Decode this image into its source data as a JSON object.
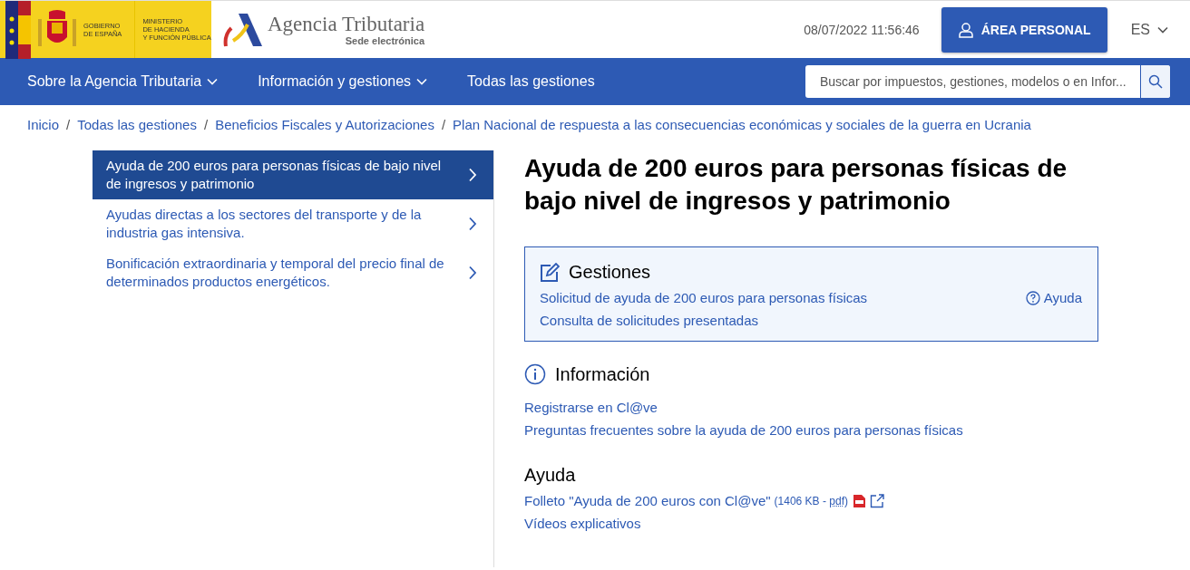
{
  "header": {
    "gov_logo": {
      "line_1": "GOBIERNO",
      "line_2": "DE ESPAÑA"
    },
    "ministry": [
      "MINISTERIO",
      "DE HACIENDA",
      "Y FUNCIÓN PÚBLICA"
    ],
    "agency": {
      "name": "Agencia Tributaria",
      "subtitle": "Sede electrónica"
    },
    "datetime": "08/07/2022 11:56:46",
    "personal_button": "ÁREA PERSONAL",
    "language": "ES"
  },
  "nav": {
    "items": [
      {
        "label": "Sobre la Agencia Tributaria",
        "has_menu": true
      },
      {
        "label": "Información y gestiones",
        "has_menu": true
      },
      {
        "label": "Todas las gestiones",
        "has_menu": false
      }
    ],
    "search": {
      "placeholder": "Buscar por impuestos, gestiones, modelos o en Infor..."
    }
  },
  "breadcrumb_separator": "/",
  "breadcrumb": [
    "Inicio",
    "Todas las gestiones",
    "Beneficios Fiscales y Autorizaciones",
    "Plan Nacional de respuesta a las consecuencias económicas y sociales de la guerra en Ucrania"
  ],
  "sidebar": {
    "items": [
      {
        "label": "Ayuda de 200 euros para personas físicas de bajo nivel de ingresos y patrimonio",
        "selected": true
      },
      {
        "label": "Ayudas directas a los sectores del transporte y de la industria gas intensiva.",
        "selected": false
      },
      {
        "label": "Bonificación extraordinaria y temporal del precio final de determinados productos energéticos.",
        "selected": false
      }
    ]
  },
  "content": {
    "title": "Ayuda de 200 euros para personas físicas de bajo nivel de ingresos y patrimonio",
    "gestiones": {
      "heading": "Gestiones",
      "links": [
        "Solicitud de ayuda de 200 euros para personas físicas",
        "Consulta de solicitudes presentadas"
      ],
      "help_link": "Ayuda"
    },
    "informacion": {
      "heading": "Información",
      "links": [
        "Registrarse en Cl@ve",
        "Preguntas frecuentes sobre la ayuda de 200 euros para personas físicas"
      ]
    },
    "ayuda": {
      "heading": "Ayuda",
      "items": [
        {
          "label": "Folleto \"Ayuda de 200 euros con Cl@ve\"",
          "size": "(1406 KB - ",
          "format": "pdf",
          "size_end": ")",
          "kind": "file"
        },
        {
          "label": "Vídeos explicativos",
          "kind": "link"
        }
      ]
    }
  }
}
